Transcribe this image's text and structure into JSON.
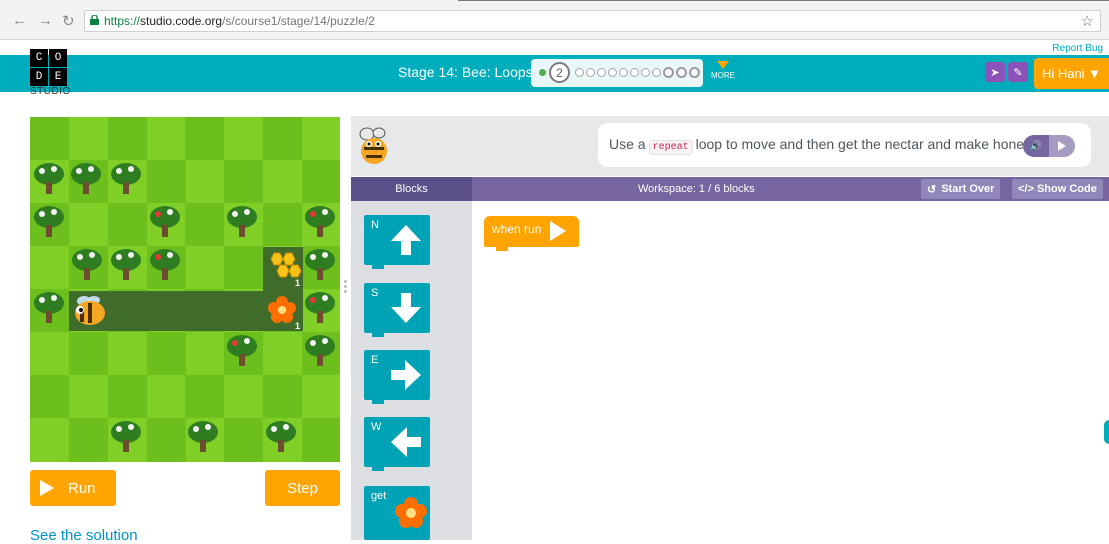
{
  "browser": {
    "url_secure": "https://",
    "url_host": "studio.code.org",
    "url_path": "/s/course1/stage/14/puzzle/2"
  },
  "header": {
    "report_bug": "Report Bug",
    "logo_letters": [
      "C",
      "O",
      "D",
      "E"
    ],
    "logo_sub": "STUDIO",
    "stage_title": "Stage 14: Bee: Loops",
    "current_puzzle": "2",
    "more_label": "MORE",
    "user_greeting": "Hi Hani ▼",
    "colors": {
      "bar": "#00adbc",
      "accent": "#ffa400",
      "purple": "#8c52ba"
    }
  },
  "game": {
    "run_label": "Run",
    "step_label": "Step",
    "see_solution": "See the solution",
    "counter_honeycomb": "1",
    "counter_flower": "1"
  },
  "instructions": {
    "before": "Use a",
    "code_word": "repeat",
    "after": "loop to move and then get the nectar and make honey!"
  },
  "workspace": {
    "tab_blocks": "Blocks",
    "title": "Workspace: 1 / 6 blocks",
    "start_over": "Start Over",
    "show_code": "</> Show Code"
  },
  "toolbox": {
    "blocks": [
      {
        "label": "N",
        "icon": "arrow-up-icon"
      },
      {
        "label": "S",
        "icon": "arrow-down-icon"
      },
      {
        "label": "E",
        "icon": "arrow-right-icon"
      },
      {
        "label": "W",
        "icon": "arrow-left-icon"
      },
      {
        "label": "get",
        "icon": "flower-icon"
      }
    ]
  },
  "program": {
    "when_run": "when run"
  }
}
